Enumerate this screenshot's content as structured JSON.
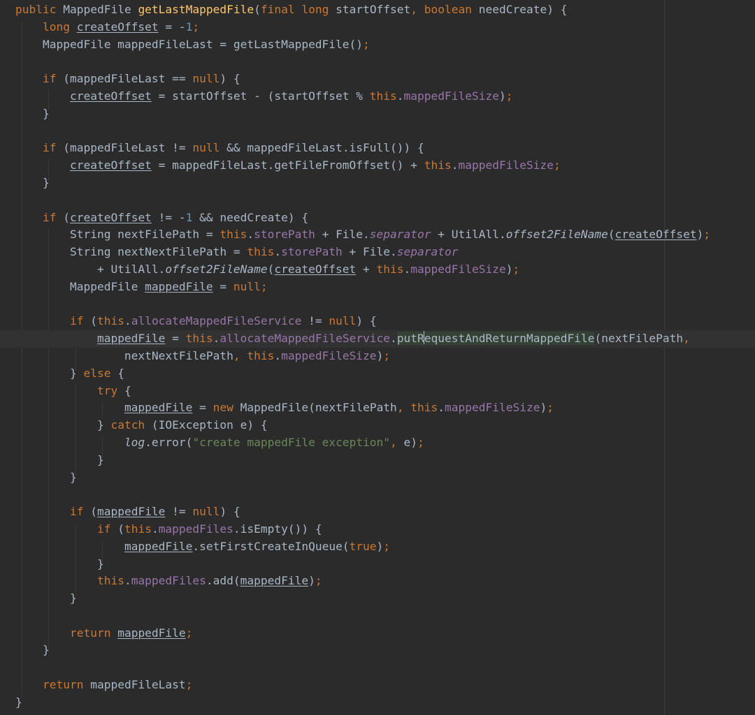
{
  "editor": {
    "theme_colors": {
      "background": "#2b2b2b",
      "default_text": "#a9b7c6",
      "keyword": "#cc7832",
      "method_declaration": "#ffc66d",
      "field": "#9876aa",
      "number": "#6897bb",
      "string": "#6a8759"
    },
    "code_lines": [
      "public MappedFile getLastMappedFile(final long startOffset, boolean needCreate) {",
      "    long createOffset = -1;",
      "    MappedFile mappedFileLast = getLastMappedFile();",
      "",
      "    if (mappedFileLast == null) {",
      "        createOffset = startOffset - (startOffset % this.mappedFileSize);",
      "    }",
      "",
      "    if (mappedFileLast != null && mappedFileLast.isFull()) {",
      "        createOffset = mappedFileLast.getFileFromOffset() + this.mappedFileSize;",
      "    }",
      "",
      "    if (createOffset != -1 && needCreate) {",
      "        String nextFilePath = this.storePath + File.separator + UtilAll.offset2FileName(createOffset);",
      "        String nextNextFilePath = this.storePath + File.separator",
      "            + UtilAll.offset2FileName(createOffset + this.mappedFileSize);",
      "        MappedFile mappedFile = null;",
      "",
      "        if (this.allocateMappedFileService != null) {",
      "            mappedFile = this.allocateMappedFileService.putRequestAndReturnMappedFile(nextFilePath,",
      "                nextNextFilePath, this.mappedFileSize);",
      "        } else {",
      "            try {",
      "                mappedFile = new MappedFile(nextFilePath, this.mappedFileSize);",
      "            } catch (IOException e) {",
      "                log.error(\"create mappedFile exception\", e);",
      "            }",
      "        }",
      "",
      "        if (mappedFile != null) {",
      "            if (this.mappedFiles.isEmpty()) {",
      "                mappedFile.setFirstCreateInQueue(true);",
      "            }",
      "            this.mappedFiles.add(mappedFile);",
      "        }",
      "",
      "        return mappedFile;",
      "    }",
      "",
      "    return mappedFileLast;",
      "}"
    ],
    "caret_line": 20,
    "caret_column": 60
  }
}
